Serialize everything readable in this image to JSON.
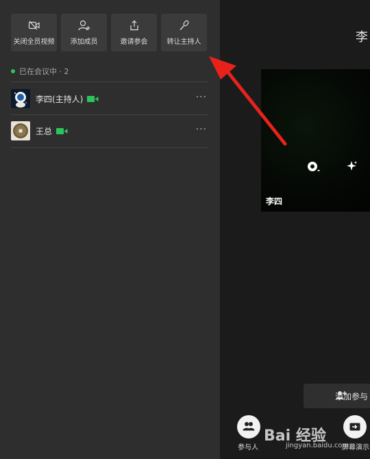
{
  "toolbar": {
    "buttons": [
      {
        "label": "关闭全员视频",
        "icon": "video-off-icon"
      },
      {
        "label": "添加成员",
        "icon": "add-member-icon"
      },
      {
        "label": "邀请参会",
        "icon": "share-icon"
      },
      {
        "label": "转让主持人",
        "icon": "microphone-icon"
      }
    ]
  },
  "participants": {
    "status": "已在会议中 · 2",
    "status_color": "#2ec45c",
    "members": [
      {
        "name": "李四(主持人)",
        "more": "···"
      },
      {
        "name": "王总",
        "more": "···"
      }
    ]
  },
  "stage": {
    "title": "李",
    "tile_name": "李四",
    "add_participant": "添加参与",
    "participants_label": "参与人",
    "screen_share_label": "屏幕演示"
  },
  "watermark": {
    "main": "Bai  经验",
    "sub": "jingyan.baidu.com"
  },
  "accent": {
    "arrow": "#e8221b",
    "camera": "#2ec45c"
  }
}
